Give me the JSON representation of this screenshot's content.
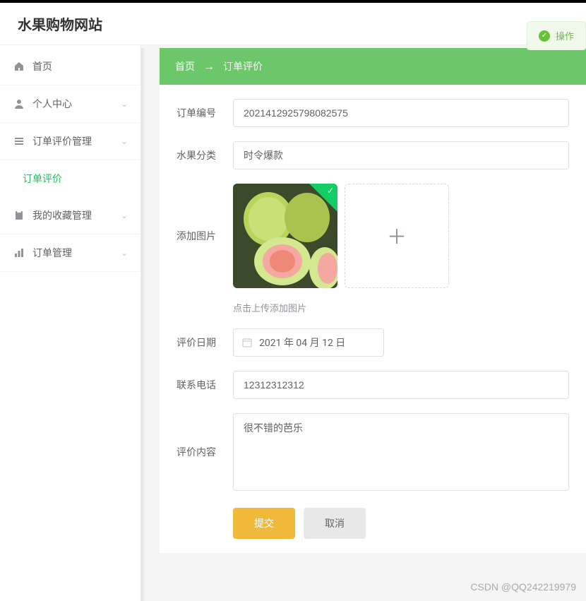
{
  "header": {
    "site_title": "水果购物网站"
  },
  "toast": {
    "text": "操作"
  },
  "sidebar": {
    "items": [
      {
        "label": "首页",
        "icon": "home"
      },
      {
        "label": "个人中心",
        "icon": "user"
      },
      {
        "label": "订单评价管理",
        "icon": "list"
      },
      {
        "label": "订单评价",
        "icon": "",
        "sub": true
      },
      {
        "label": "我的收藏管理",
        "icon": "clipboard"
      },
      {
        "label": "订单管理",
        "icon": "stats"
      }
    ]
  },
  "breadcrumb": {
    "home": "首页",
    "arrow": "→",
    "current": "订单评价"
  },
  "form": {
    "order_no_label": "订单编号",
    "order_no_value": "2021412925798082575",
    "category_label": "水果分类",
    "category_value": "时令爆款",
    "add_image_label": "添加图片",
    "upload_hint": "点击上传添加图片",
    "date_label": "评价日期",
    "date_value": "2021 年 04 月 12 日",
    "phone_label": "联系电话",
    "phone_value": "12312312312",
    "content_label": "评价内容",
    "content_value": "很不错的芭乐",
    "submit_label": "提交",
    "cancel_label": "取消"
  },
  "watermark": "CSDN @QQ242219979"
}
